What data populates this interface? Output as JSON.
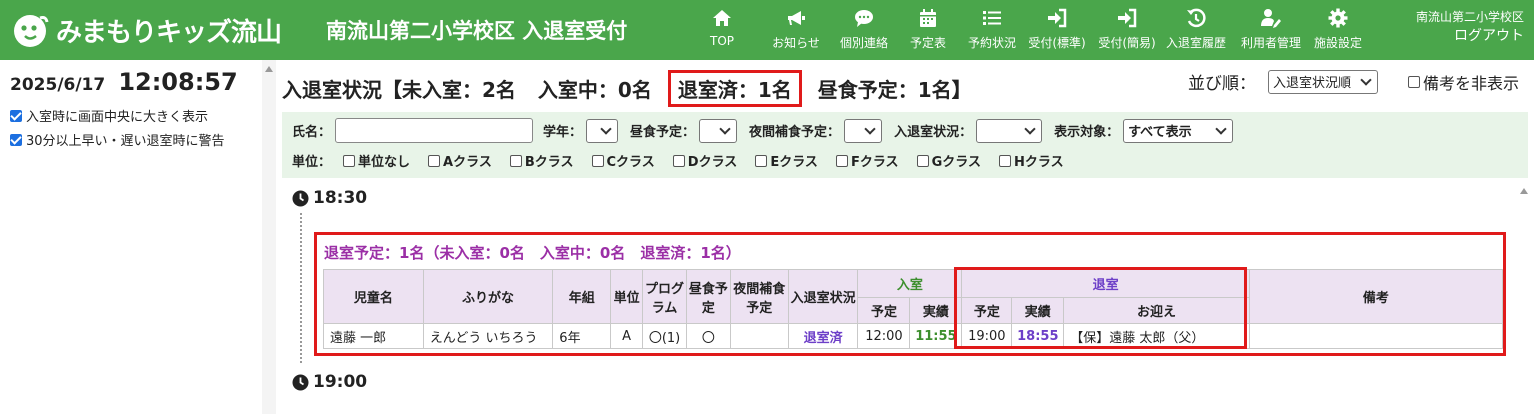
{
  "header": {
    "logo_text": "みまもりキッズ流山",
    "page_title": "南流山第二小学校区 入退室受付",
    "nav": [
      {
        "label": "TOP",
        "icon": "home-icon"
      },
      {
        "label": "お知らせ",
        "icon": "megaphone-icon"
      },
      {
        "label": "個別連絡",
        "icon": "chat-icon"
      },
      {
        "label": "予定表",
        "icon": "calendar-icon"
      },
      {
        "label": "予約状況",
        "icon": "list-icon"
      },
      {
        "label": "受付(標準)",
        "icon": "sign-in-icon"
      },
      {
        "label": "受付(簡易)",
        "icon": "sign-in-icon"
      },
      {
        "label": "入退室履歴",
        "icon": "history-icon"
      },
      {
        "label": "利用者管理",
        "icon": "user-edit-icon"
      },
      {
        "label": "施設設定",
        "icon": "gear-icon"
      }
    ],
    "school_name": "南流山第二小学校区",
    "logout": "ログアウト",
    "brand_color": "#4aa64b"
  },
  "left": {
    "date": "2025/6/17",
    "time": "12:08:57",
    "options": [
      {
        "label": "入室時に画面中央に大きく表示",
        "checked": true
      },
      {
        "label": "30分以上早い・遅い退室時に警告",
        "checked": true
      }
    ]
  },
  "summary": {
    "part1": "入退室状況【未入室：2名",
    "part2": "入室中：0名",
    "part3": "退室済：1名",
    "part4": "昼食予定：1名】"
  },
  "sort": {
    "label": "並び順：",
    "value": "入退室状況順",
    "hide_notes_label": "備考を非表示"
  },
  "filter": {
    "name_label": "氏名：",
    "grade_label": "学年：",
    "lunch_label": "昼食予定：",
    "night_label": "夜間補食予定：",
    "status_label": "入退室状況：",
    "target_label": "表示対象：",
    "target_value": "すべて表示",
    "unit_label": "単位：",
    "units": [
      "単位なし",
      "Aクラス",
      "Bクラス",
      "Cクラス",
      "Dクラス",
      "Eクラス",
      "Fクラス",
      "Gクラス",
      "Hクラス"
    ]
  },
  "timeline": {
    "slot1": "18:30",
    "slot2": "19:00"
  },
  "group": {
    "title": "退室予定：1名（未入室：0名　入室中：0名　退室済：1名）",
    "headers": {
      "name": "児童名",
      "kana": "ふりがな",
      "grade": "年組",
      "unit": "単位",
      "program": "プログラム",
      "lunch": "昼食予定",
      "night": "夜間補食予定",
      "status": "入退室状況",
      "in": "入室",
      "out": "退室",
      "plan": "予定",
      "actual": "実績",
      "pickup": "お迎え",
      "note": "備考"
    },
    "rows": [
      {
        "name": "遠藤 一郎",
        "kana": "えんどう いちろう",
        "grade": "6年",
        "unit": "A",
        "program": "〇(1)",
        "lunch": "〇",
        "night": "",
        "status": "退室済",
        "in_plan": "12:00",
        "in_actual": "11:55",
        "out_plan": "19:00",
        "out_actual": "18:55",
        "pickup": "【保】遠藤 太郎（父）",
        "note": ""
      }
    ]
  }
}
